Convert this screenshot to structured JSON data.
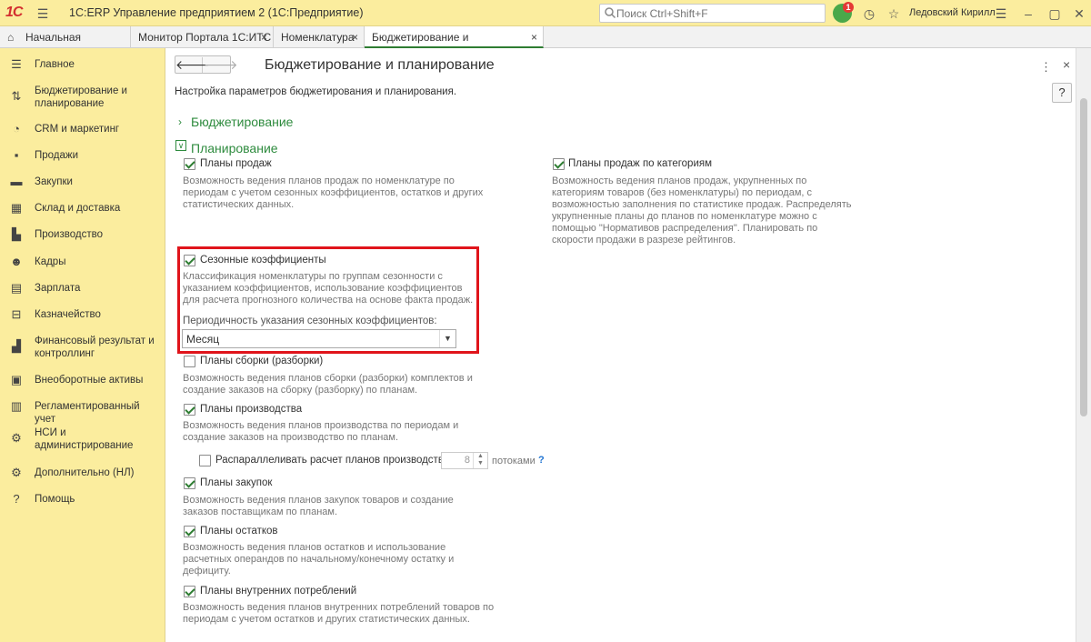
{
  "titlebar": {
    "logo_text": "1С",
    "app_title": "1С:ERP Управление предприятием 2  (1С:Предприятие)",
    "search_placeholder": "Поиск Ctrl+Shift+F",
    "notif_count": "1",
    "user_name": "Ледовский Кирилл"
  },
  "tabs": [
    {
      "label": "Начальная страница"
    },
    {
      "label": "Монитор Портала 1С:ИТС"
    },
    {
      "label": "Номенклатура"
    },
    {
      "label": "Бюджетирование и планирование"
    }
  ],
  "tab_close": "×",
  "sidebar": {
    "items": [
      {
        "label": "Главное",
        "icon": "☰"
      },
      {
        "label": "Бюджетирование и планирование",
        "icon": "⇅"
      },
      {
        "label": "CRM и маркетинг",
        "icon": "◔"
      },
      {
        "label": "Продажи",
        "icon": "▪"
      },
      {
        "label": "Закупки",
        "icon": "▬"
      },
      {
        "label": "Склад и доставка",
        "icon": "▦"
      },
      {
        "label": "Производство",
        "icon": "▙"
      },
      {
        "label": "Кадры",
        "icon": "☻"
      },
      {
        "label": "Зарплата",
        "icon": "▤"
      },
      {
        "label": "Казначейство",
        "icon": "⊟"
      },
      {
        "label": "Финансовый результат и контроллинг",
        "icon": "▟"
      },
      {
        "label": "Внеоборотные активы",
        "icon": "▣"
      },
      {
        "label": "Регламентированный учет",
        "icon": "▥"
      },
      {
        "label": "НСИ и администрирование",
        "icon": "⚙"
      },
      {
        "label": "Дополнительно (НЛ)",
        "icon": "⚙"
      },
      {
        "label": "Помощь",
        "icon": "?"
      }
    ]
  },
  "main": {
    "nav_back": "🡐",
    "nav_forward": "🡒",
    "title": "Бюджетирование и планирование",
    "subtitle": "Настройка параметров бюджетирования и планирования.",
    "help_label": "?",
    "menu_label": "⋮",
    "close_label": "×",
    "section_budget": "Бюджетирование",
    "section_planning": "Планирование",
    "options": {
      "sales_plans": {
        "label": "Планы продаж",
        "desc": "Возможность ведения планов продаж по номенклатуре по периодам с учетом сезонных коэффициентов, остатков и других статистических данных."
      },
      "sales_by_cat": {
        "label": "Планы продаж по категориям",
        "desc": "Возможность ведения планов продаж, укрупненных по категориям товаров (без номенклатуры) по периодам, с возможностью заполнения по статистике продаж. Распределять укрупненные планы до планов по номенклатуре можно с помощью \"Нормативов распределения\". Планировать по скорости продажи в разрезе рейтингов."
      },
      "seasonal": {
        "label": "Сезонные коэффициенты",
        "desc": "Классификация номенклатуры по группам сезонности с указанием коэффициентов, использование коэффициентов для расчета прогнозного количества на основе факта продаж."
      },
      "periodicity_label": "Периодичность указания сезонных коэффициентов:",
      "periodicity_value": "Месяц",
      "assembly": {
        "label": "Планы сборки (разборки)",
        "desc": "Возможность ведения планов сборки (разборки) комплектов и создание заказов на сборку (разборку) по планам."
      },
      "production": {
        "label": "Планы производства",
        "desc": "Возможность ведения планов производства по периодам и создание заказов на производство по планам."
      },
      "parallel": {
        "label": "Распараллеливать расчет планов производства",
        "threads": "8",
        "threads_unit": "потоками"
      },
      "purchase": {
        "label": "Планы закупок",
        "desc": "Возможность ведения планов закупок товаров и создание заказов поставщикам по планам."
      },
      "stock": {
        "label": "Планы остатков",
        "desc": "Возможность ведения планов остатков и использование расчетных операндов по начальному/конечному остатку и дефициту."
      },
      "internal": {
        "label": "Планы внутренних потреблений",
        "desc": "Возможность ведения планов внутренних потреблений товаров по периодам с учетом остатков и других статистических данных."
      }
    }
  },
  "colors": {
    "accent_green": "#2e8b3e",
    "titlebar_bg": "#fbed9e",
    "highlight_red": "#e0141b"
  }
}
